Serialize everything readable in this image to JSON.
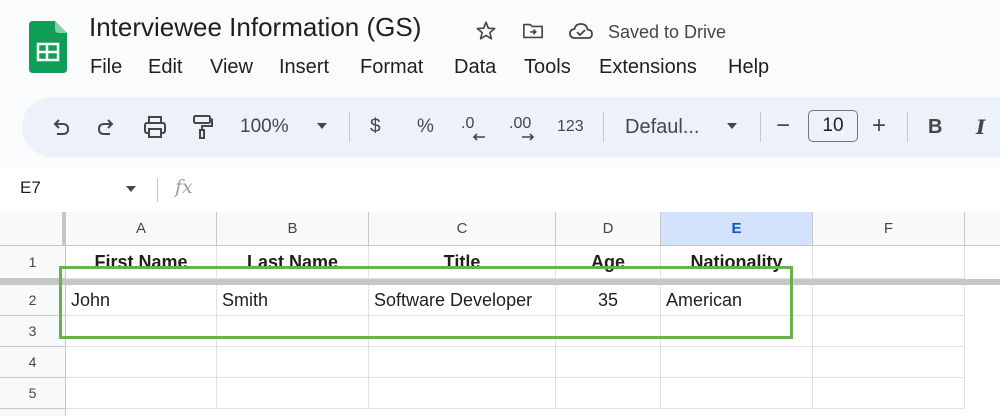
{
  "document": {
    "title": "Interviewee Information (GS)",
    "save_status": "Saved to Drive"
  },
  "menu": [
    "File",
    "Edit",
    "View",
    "Insert",
    "Format",
    "Data",
    "Tools",
    "Extensions",
    "Help"
  ],
  "toolbar": {
    "zoom": "100%",
    "currency": "$",
    "percent": "%",
    "decrease_decimal": ".0",
    "increase_decimal": ".00",
    "number_format": "123",
    "font": "Defaul...",
    "font_size": "10",
    "minus": "−",
    "plus": "+",
    "bold": "B",
    "italic": "I"
  },
  "formula_bar": {
    "name_box": "E7",
    "fx": "fx"
  },
  "columns": [
    "A",
    "B",
    "C",
    "D",
    "E",
    "F"
  ],
  "selected_column": "E",
  "rows": [
    "1",
    "2",
    "3",
    "4",
    "5"
  ],
  "cells": {
    "r1": [
      "First Name",
      "Last Name",
      "Title",
      "Age",
      "Nationality"
    ],
    "r2": [
      "John",
      "Smith",
      "Software Developer",
      "35",
      "American"
    ]
  },
  "colors": {
    "highlight_border": "#6ab04c",
    "sheets_green": "#0f9d58",
    "selected_header": "#d3e3fd"
  }
}
